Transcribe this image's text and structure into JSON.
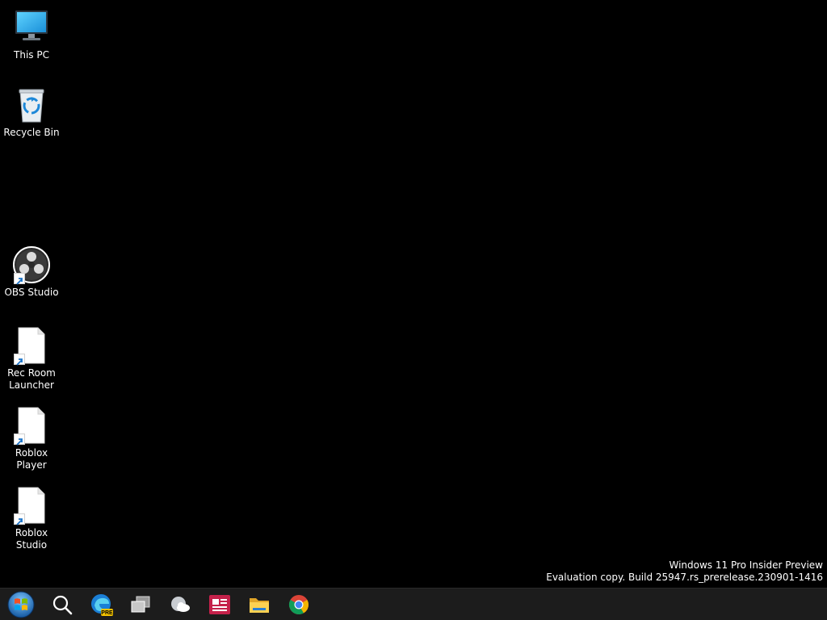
{
  "desktop": {
    "icons": [
      {
        "id": "this-pc",
        "label": "This PC",
        "icon": "computer-monitor-icon"
      },
      {
        "id": "recycle-bin",
        "label": "Recycle Bin",
        "icon": "recycle-bin-icon"
      },
      {
        "id": "obs-studio",
        "label": "OBS Studio",
        "icon": "obs-studio-icon",
        "shortcut": true
      },
      {
        "id": "rec-room-launcher",
        "label": "Rec Room\nLauncher",
        "icon": "blank-file-icon",
        "shortcut": true
      },
      {
        "id": "roblox-player",
        "label": "Roblox Player",
        "icon": "blank-file-icon",
        "shortcut": true
      },
      {
        "id": "roblox-studio",
        "label": "Roblox Studio",
        "icon": "blank-file-icon",
        "shortcut": true
      }
    ]
  },
  "watermark": {
    "line1": "Windows 11 Pro Insider Preview",
    "line2": "Evaluation copy. Build 25947.rs_prerelease.230901-1416"
  },
  "taskbar": {
    "items": [
      {
        "id": "start",
        "icon": "windows-start-orb-icon"
      },
      {
        "id": "search",
        "icon": "search-icon"
      },
      {
        "id": "edge-preview",
        "icon": "edge-preview-icon",
        "badge": "PRE"
      },
      {
        "id": "task-view",
        "icon": "task-view-icon"
      },
      {
        "id": "widgets",
        "icon": "weather-widget-icon"
      },
      {
        "id": "news",
        "icon": "news-app-icon"
      },
      {
        "id": "file-explorer",
        "icon": "folder-icon"
      },
      {
        "id": "chrome",
        "icon": "chrome-icon"
      }
    ]
  },
  "colors": {
    "desktop_bg": "#000000",
    "taskbar_bg": "#1c1c1c",
    "text": "#ffffff"
  }
}
